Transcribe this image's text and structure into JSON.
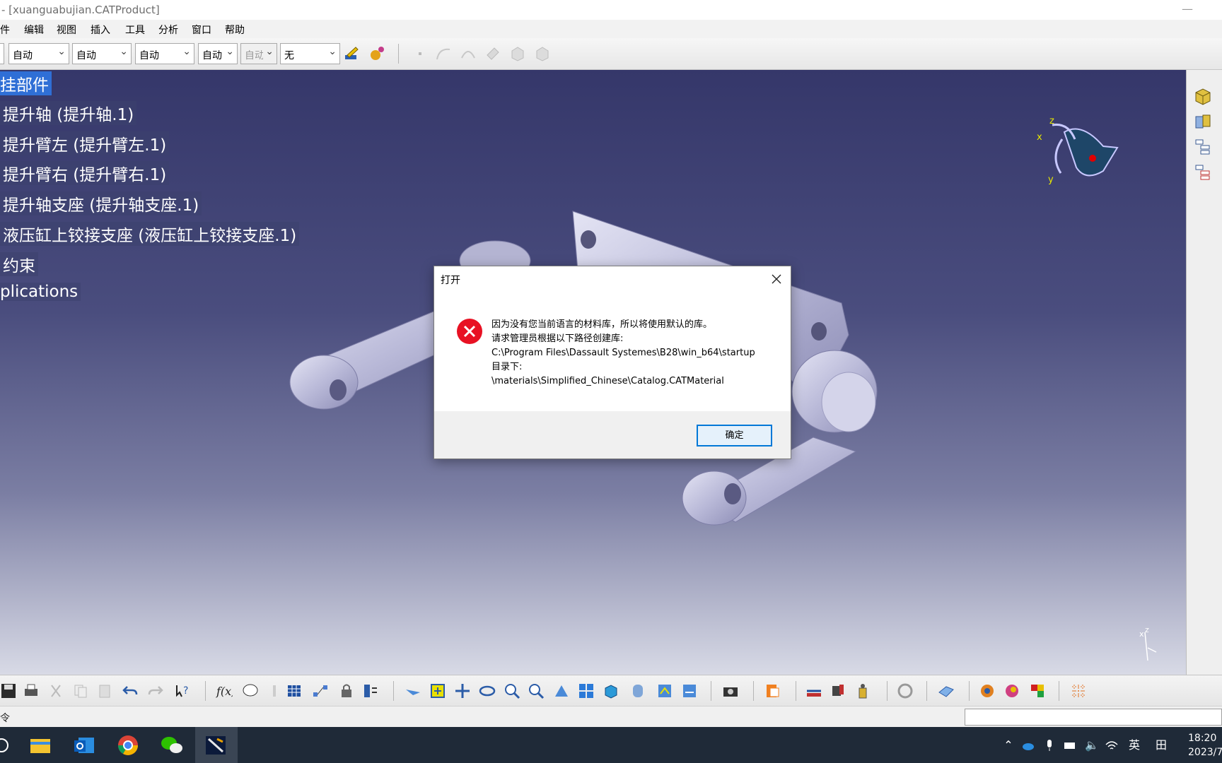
{
  "window": {
    "title": "- [xuanguabujian.CATProduct]",
    "minimize_glyph": "—"
  },
  "menu": [
    "件",
    "编辑",
    "视图",
    "插入",
    "工具",
    "分析",
    "窗口",
    "帮助"
  ],
  "toolbar": {
    "combos": [
      {
        "value": "自动",
        "disabled": false
      },
      {
        "value": "自动",
        "disabled": false
      },
      {
        "value": "自动",
        "disabled": false
      },
      {
        "value": "自动",
        "disabled": false
      },
      {
        "value": "自动",
        "disabled": true
      },
      {
        "value": "无",
        "disabled": false
      }
    ],
    "icons": [
      "paint-brush-icon",
      "material-ball-icon",
      "point-icon",
      "curve-icon",
      "arc-icon",
      "eraser-icon",
      "part-icon",
      "part-copy-icon"
    ]
  },
  "tree": {
    "items": [
      "挂部件",
      "提升轴 (提升轴.1)",
      "提升臂左 (提升臂左.1)",
      "提升臂右 (提升臂右.1)",
      "提升轴支座 (提升轴支座.1)",
      "液压缸上铰接支座 (液压缸上铰接支座.1)",
      "约束",
      "plications"
    ],
    "selected_index": 0
  },
  "compass": {
    "x_label": "x",
    "y_label": "y",
    "z_label": "z"
  },
  "mini_axis": {
    "x_label": "x",
    "z_label": "z"
  },
  "right_toolbar": {
    "icons": [
      "product-icon",
      "component-icon",
      "tree-expand-icon",
      "tree-collapse-icon"
    ]
  },
  "bottom_toolbar": {
    "icons": [
      "save-icon",
      "print-icon",
      "cut-icon",
      "copy-icon",
      "paste-icon",
      "undo-icon",
      "redo-icon",
      "whats-this-icon",
      "formula-icon",
      "comment-icon",
      "sensor-icon",
      "table-icon",
      "graph-icon",
      "lock-icon",
      "parameters-icon",
      "fly-mode-icon",
      "fit-all-icon",
      "pan-icon",
      "rotate-icon",
      "zoom-in-icon",
      "zoom-out-icon",
      "normal-view-icon",
      "multi-view-icon",
      "iso-view-icon",
      "render-style-icon",
      "hide-show-icon",
      "swap-visible-icon",
      "capture-icon",
      "catalog-icon",
      "measure-between-icon",
      "measure-item-icon",
      "measure-inertia-icon",
      "update-icon",
      "plane-icon",
      "material-icon",
      "apply-material-icon",
      "style-icon",
      "grid-icon"
    ]
  },
  "cmdbar": {
    "label": "令"
  },
  "taskbar": {
    "apps": [
      "start-icon",
      "file-explorer-icon",
      "outlook-icon",
      "chrome-icon",
      "wechat-icon",
      "catia-icon"
    ],
    "tray": [
      "chevron-up-icon",
      "onedrive-icon",
      "microphone-icon",
      "battery-icon",
      "volume-icon",
      "wifi-icon"
    ],
    "ime_label": "英",
    "ime2_label": "田",
    "time": "18:20",
    "date": "2023/7"
  },
  "dialog": {
    "title": "打开",
    "lines": [
      "因为没有您当前语言的材料库，所以将使用默认的库。",
      "请求管理员根据以下路径创建库:",
      "C:\\Program Files\\Dassault Systemes\\B28\\win_b64\\startup",
      "目录下:",
      "\\materials\\Simplified_Chinese\\Catalog.CATMaterial"
    ],
    "ok_label": "确定"
  },
  "colors": {
    "viewport_top": "#35376a",
    "viewport_bottom": "#d8dae6",
    "tree_selection": "#2f6fd6",
    "error_red": "#e81123",
    "ok_border": "#0078d7",
    "taskbar": "#1f2a38"
  }
}
